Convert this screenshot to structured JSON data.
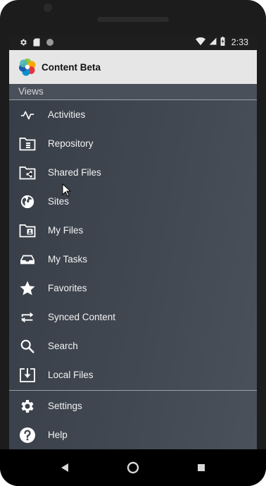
{
  "status_bar": {
    "time": "2:33",
    "icons": [
      "gear-icon",
      "sd-card-icon",
      "circle-icon",
      "wifi-icon",
      "cell-signal-icon",
      "battery-charging-icon"
    ]
  },
  "app_bar": {
    "title": "Content Beta",
    "logo": "alfresco-flower-logo"
  },
  "drawer": {
    "section_header": "Views",
    "items": [
      {
        "label": "Activities",
        "icon": "activity-pulse-icon"
      },
      {
        "label": "Repository",
        "icon": "folder-database-icon"
      },
      {
        "label": "Shared Files",
        "icon": "folder-share-icon"
      },
      {
        "label": "Sites",
        "icon": "globe-icon"
      },
      {
        "label": "My Files",
        "icon": "folder-person-icon"
      },
      {
        "label": "My Tasks",
        "icon": "inbox-tray-icon"
      },
      {
        "label": "Favorites",
        "icon": "star-icon"
      },
      {
        "label": "Synced Content",
        "icon": "sync-arrows-icon"
      },
      {
        "label": "Search",
        "icon": "search-icon"
      },
      {
        "label": "Local Files",
        "icon": "download-box-icon"
      }
    ],
    "footer_items": [
      {
        "label": "Settings",
        "icon": "gear-icon"
      },
      {
        "label": "Help",
        "icon": "help-circle-icon"
      }
    ]
  },
  "nav_bar": {
    "buttons": [
      "back-icon",
      "home-icon",
      "recents-icon"
    ]
  },
  "colors": {
    "drawer_background": "#414852",
    "app_bar_background": "#e6e6e6",
    "status_bar_background": "#1e1e1e",
    "text": "#f2f2f2"
  }
}
